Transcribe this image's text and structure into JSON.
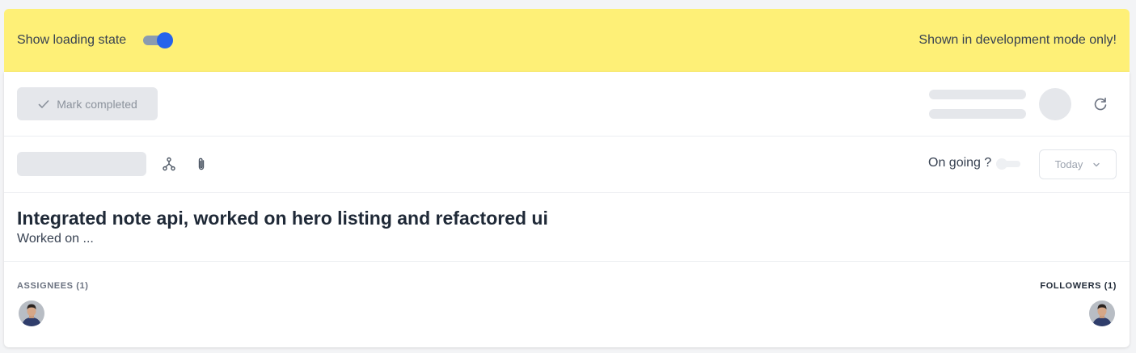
{
  "banner": {
    "label": "Show loading state",
    "note": "Shown in development mode only!",
    "toggle_on": true,
    "background": "#fef077",
    "toggle_color": "#2563eb"
  },
  "toolbar": {
    "mark_completed_label": "Mark completed",
    "icons": [
      "check-icon",
      "refresh-icon"
    ]
  },
  "meta_row": {
    "icons": [
      "subtask-tree-icon",
      "paperclip-icon"
    ],
    "ongoing_label": "On going ?",
    "date_select": {
      "value": "Today",
      "icon": "chevron-down-icon"
    }
  },
  "task": {
    "title": "Integrated note api, worked on hero listing and refactored ui",
    "description": "Worked on ..."
  },
  "people": {
    "assignees_label": "ASSIGNEES (1)",
    "followers_label": "FOLLOWERS (1)"
  },
  "colors": {
    "skeleton": "#e5e7eb",
    "muted_text": "#8b929c",
    "accent": "#2563eb"
  }
}
